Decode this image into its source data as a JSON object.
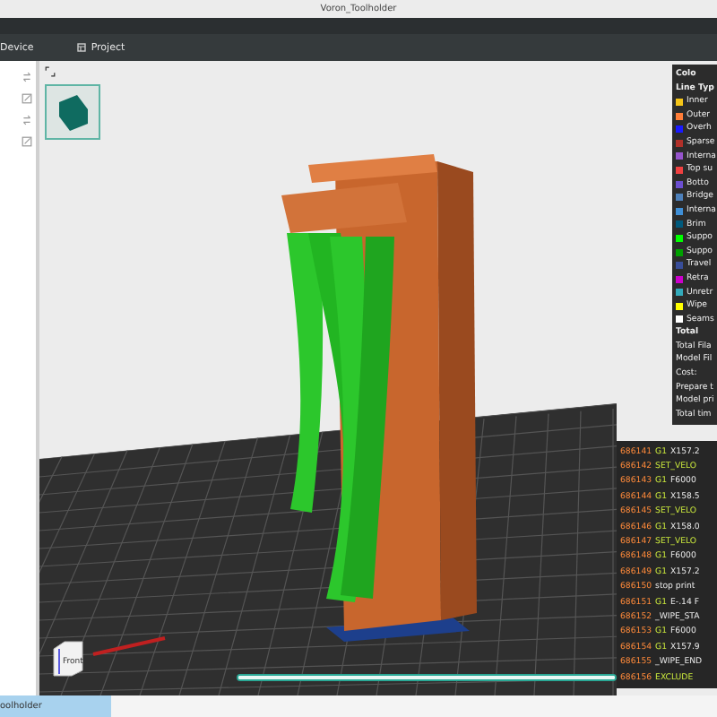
{
  "window": {
    "title": "Voron_Toolholder"
  },
  "toolbar": {
    "tabs": [
      {
        "label": "Device",
        "selected": false
      },
      {
        "label": "Project",
        "selected": false
      }
    ]
  },
  "view_cube": {
    "label": "Front"
  },
  "legend": {
    "title": "Colo",
    "subtitle": "Line Typ",
    "items": [
      {
        "name": "Inner",
        "color": "#f5c518"
      },
      {
        "name": "Outer",
        "color": "#ff7d38"
      },
      {
        "name": "Overh",
        "color": "#1a1aff"
      },
      {
        "name": "Sparse",
        "color": "#b03029"
      },
      {
        "name": "Interna",
        "color": "#9654cc"
      },
      {
        "name": "Top su",
        "color": "#f04040"
      },
      {
        "name": "Botto",
        "color": "#6b4ecf"
      },
      {
        "name": "Bridge",
        "color": "#4d80ba"
      },
      {
        "name": "Interna",
        "color": "#3f8fd6"
      },
      {
        "name": "Brim",
        "color": "#00597c"
      },
      {
        "name": "Suppo",
        "color": "#00ff00"
      },
      {
        "name": "Suppo",
        "color": "#00a000"
      },
      {
        "name": "Travel",
        "color": "#384d99"
      },
      {
        "name": "Retra",
        "color": "#cc00cc"
      },
      {
        "name": "Unretr",
        "color": "#33aabb"
      },
      {
        "name": "Wipe",
        "color": "#ffff00"
      },
      {
        "name": "Seams",
        "color": "#ffffff"
      }
    ],
    "stats": [
      "Total",
      "Total Fila",
      "Model Fil",
      "Cost:",
      "Prepare t",
      "Model pri",
      "Total tim"
    ]
  },
  "gcode": {
    "lines": [
      {
        "number": "686141",
        "cmd": "G1",
        "args": "X157.2"
      },
      {
        "number": "686142",
        "cmd": "SET_VELO"
      },
      {
        "number": "686143",
        "cmd": "G1",
        "args": "F6000"
      },
      {
        "number": "686144",
        "cmd": "G1",
        "args": "X158.5"
      },
      {
        "number": "686145",
        "cmd": "SET_VELO"
      },
      {
        "number": "686146",
        "cmd": "G1",
        "args": "X158.0"
      },
      {
        "number": "686147",
        "cmd": "SET_VELO"
      },
      {
        "number": "686148",
        "cmd": "G1",
        "args": "F6000"
      },
      {
        "number": "686149",
        "cmd": "G1",
        "args": "X157.2"
      },
      {
        "number": "686150",
        "args": "stop print"
      },
      {
        "number": "686151",
        "cmd": "G1",
        "args": "E-.14 F"
      },
      {
        "number": "686152",
        "args": "_WIPE_STA"
      },
      {
        "number": "686153",
        "cmd": "G1",
        "args": "F6000"
      },
      {
        "number": "686154",
        "cmd": "G1",
        "args": "X157.9"
      },
      {
        "number": "686155",
        "args": "_WIPE_END"
      },
      {
        "number": "686156",
        "cmd": "EXCLUDE"
      }
    ]
  },
  "layer_slider": {
    "level": 1
  },
  "bottom_bar": {
    "tab": "oolholder"
  }
}
